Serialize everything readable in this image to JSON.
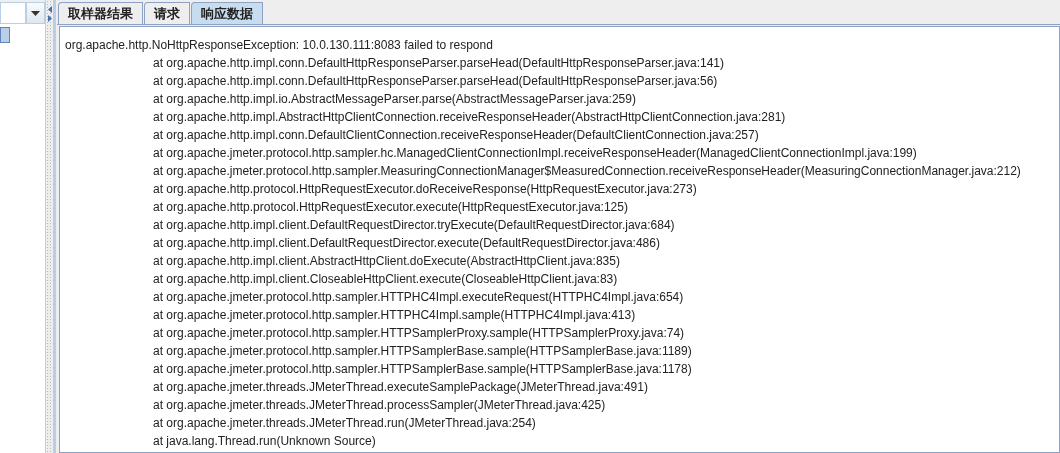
{
  "left_panel": {
    "list": [
      {
        "selected": true
      }
    ]
  },
  "tabs": [
    {
      "label": "取样器结果",
      "selected": false
    },
    {
      "label": "请求",
      "selected": false
    },
    {
      "label": "响应数据",
      "selected": true
    }
  ],
  "response": {
    "exception": "org.apache.http.NoHttpResponseException: 10.0.130.111:8083 failed to respond",
    "stack": [
      "at org.apache.http.impl.conn.DefaultHttpResponseParser.parseHead(DefaultHttpResponseParser.java:141)",
      "at org.apache.http.impl.conn.DefaultHttpResponseParser.parseHead(DefaultHttpResponseParser.java:56)",
      "at org.apache.http.impl.io.AbstractMessageParser.parse(AbstractMessageParser.java:259)",
      "at org.apache.http.impl.AbstractHttpClientConnection.receiveResponseHeader(AbstractHttpClientConnection.java:281)",
      "at org.apache.http.impl.conn.DefaultClientConnection.receiveResponseHeader(DefaultClientConnection.java:257)",
      "at org.apache.jmeter.protocol.http.sampler.hc.ManagedClientConnectionImpl.receiveResponseHeader(ManagedClientConnectionImpl.java:199)",
      "at org.apache.jmeter.protocol.http.sampler.MeasuringConnectionManager$MeasuredConnection.receiveResponseHeader(MeasuringConnectionManager.java:212)",
      "at org.apache.http.protocol.HttpRequestExecutor.doReceiveResponse(HttpRequestExecutor.java:273)",
      "at org.apache.http.protocol.HttpRequestExecutor.execute(HttpRequestExecutor.java:125)",
      "at org.apache.http.impl.client.DefaultRequestDirector.tryExecute(DefaultRequestDirector.java:684)",
      "at org.apache.http.impl.client.DefaultRequestDirector.execute(DefaultRequestDirector.java:486)",
      "at org.apache.http.impl.client.AbstractHttpClient.doExecute(AbstractHttpClient.java:835)",
      "at org.apache.http.impl.client.CloseableHttpClient.execute(CloseableHttpClient.java:83)",
      "at org.apache.jmeter.protocol.http.sampler.HTTPHC4Impl.executeRequest(HTTPHC4Impl.java:654)",
      "at org.apache.jmeter.protocol.http.sampler.HTTPHC4Impl.sample(HTTPHC4Impl.java:413)",
      "at org.apache.jmeter.protocol.http.sampler.HTTPSamplerProxy.sample(HTTPSamplerProxy.java:74)",
      "at org.apache.jmeter.protocol.http.sampler.HTTPSamplerBase.sample(HTTPSamplerBase.java:1189)",
      "at org.apache.jmeter.protocol.http.sampler.HTTPSamplerBase.sample(HTTPSamplerBase.java:1178)",
      "at org.apache.jmeter.threads.JMeterThread.executeSamplePackage(JMeterThread.java:491)",
      "at org.apache.jmeter.threads.JMeterThread.processSampler(JMeterThread.java:425)",
      "at org.apache.jmeter.threads.JMeterThread.run(JMeterThread.java:254)",
      "at java.lang.Thread.run(Unknown Source)"
    ]
  }
}
